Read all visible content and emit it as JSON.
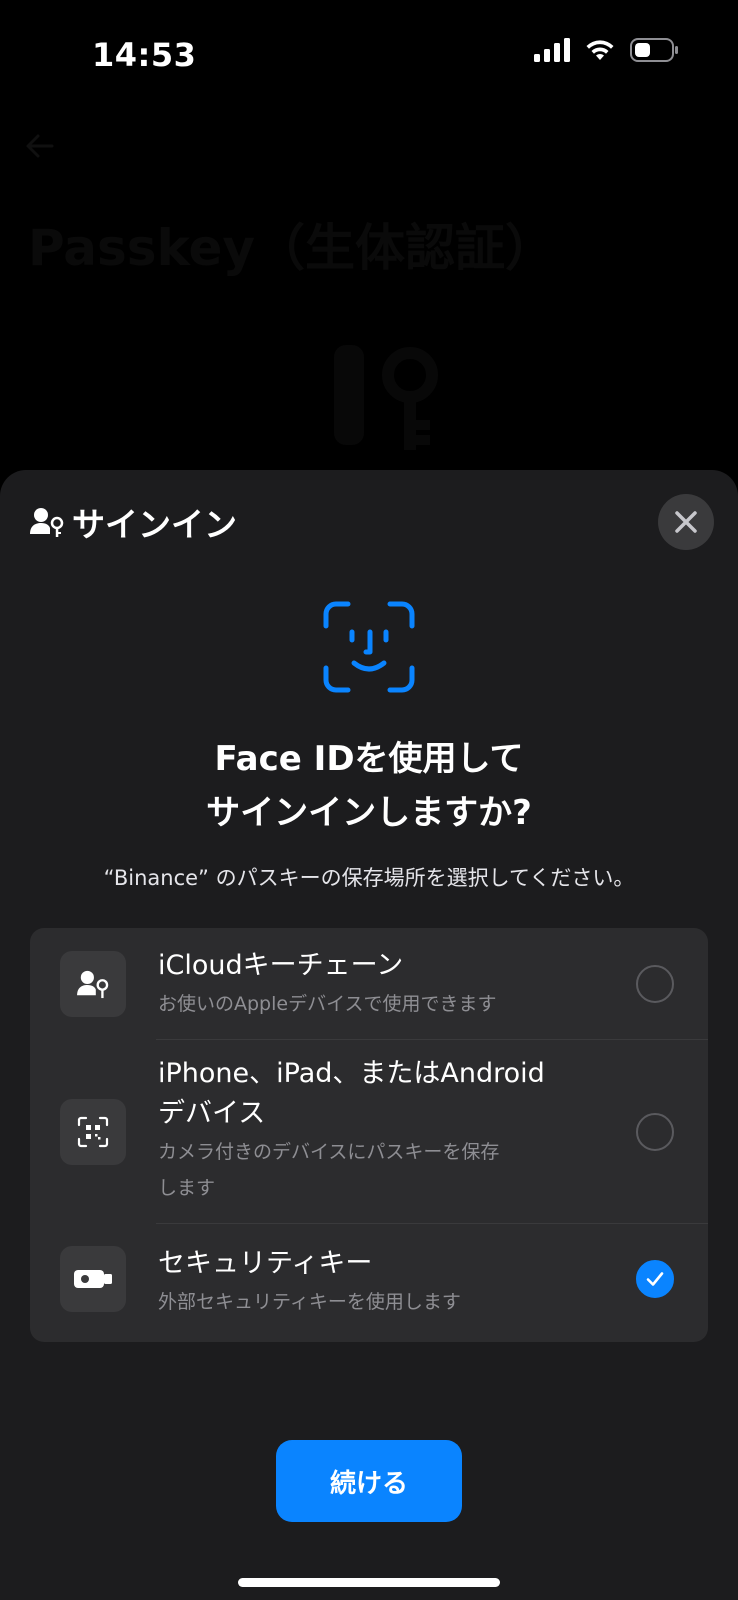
{
  "status_bar": {
    "time": "14:53"
  },
  "background_page": {
    "title": "Passkey（生体認証）"
  },
  "sheet": {
    "title": "サインイン",
    "headline_line1": "Face IDを使用して",
    "headline_line2": "サインインしますか?",
    "subtext": "“Binance” のパスキーの保存場所を選択してください。",
    "options": [
      {
        "title": "iCloudキーチェーン",
        "description": "お使いのAppleデバイスで使用できます",
        "selected": false,
        "icon": "person-key-icon"
      },
      {
        "title_line1": "iPhone、iPad、またはAndroid",
        "title_line2": "デバイス",
        "description_line1": "カメラ付きのデバイスにパスキーを保存",
        "description_line2": "します",
        "selected": false,
        "icon": "qr-scan-icon"
      },
      {
        "title": "セキュリティキー",
        "description": "外部セキュリティキーを使用します",
        "selected": true,
        "icon": "usb-key-icon"
      }
    ],
    "continue_label": "続ける"
  },
  "colors": {
    "accent": "#0a84ff",
    "sheet_bg": "#1c1c1e",
    "card_bg": "#2c2c2e"
  }
}
